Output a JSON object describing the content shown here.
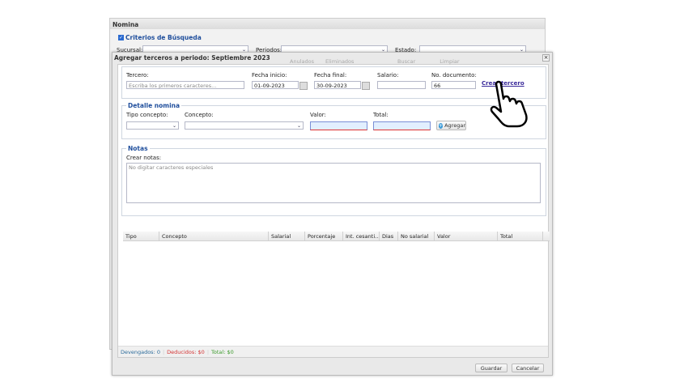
{
  "background": {
    "title": "Nomina",
    "criteria_label": "Criterios de Búsqueda",
    "sucursal_label": "Sucursal:",
    "periodos_label": "Periodos:",
    "estado_label": "Estado:",
    "anulados_label": "Anulados",
    "eliminados_label": "Eliminados",
    "buscar_label": "Buscar",
    "limpiar_label": "Limpiar"
  },
  "dialog": {
    "title": "Agregar terceros a periodo: Septiembre 2023",
    "close": "×",
    "tercero": {
      "label": "Tercero:",
      "placeholder": "Escriba los primeros caracteres..."
    },
    "fecha_inicio": {
      "label": "Fecha inicio:",
      "value": "01-09-2023"
    },
    "fecha_final": {
      "label": "Fecha final:",
      "value": "30-09-2023"
    },
    "salario": {
      "label": "Salario:",
      "value": ""
    },
    "no_documento": {
      "label": "No. documento:",
      "value": "66"
    },
    "crear_tercero": "Crear tercero",
    "detalle": {
      "legend": "Detalle nomina",
      "tipo_concepto": "Tipo concepto:",
      "concepto": "Concepto:",
      "valor": "Valor:",
      "total": "Total:",
      "agregar": "Agregar"
    },
    "notas": {
      "legend": "Notas",
      "label": "Crear notas:",
      "placeholder": "No digitar caracteres especiales"
    },
    "grid_columns": [
      "Tipo",
      "Concepto",
      "Salarial",
      "Porcentaje",
      "Int. cesanti...",
      "Dias",
      "No salarial",
      "Valor",
      "Total"
    ],
    "status": {
      "devengados": "Devengados: 0",
      "deducidos": "Deducidos: $0",
      "total": "Total: $0"
    },
    "guardar": "Guardar",
    "cancelar": "Cancelar"
  },
  "colors": {
    "legend": "#1f4e9c",
    "devengados": "#2a6a9a",
    "deducidos": "#d33333",
    "total": "#3a9a2a",
    "link": "#3a2a9a"
  }
}
